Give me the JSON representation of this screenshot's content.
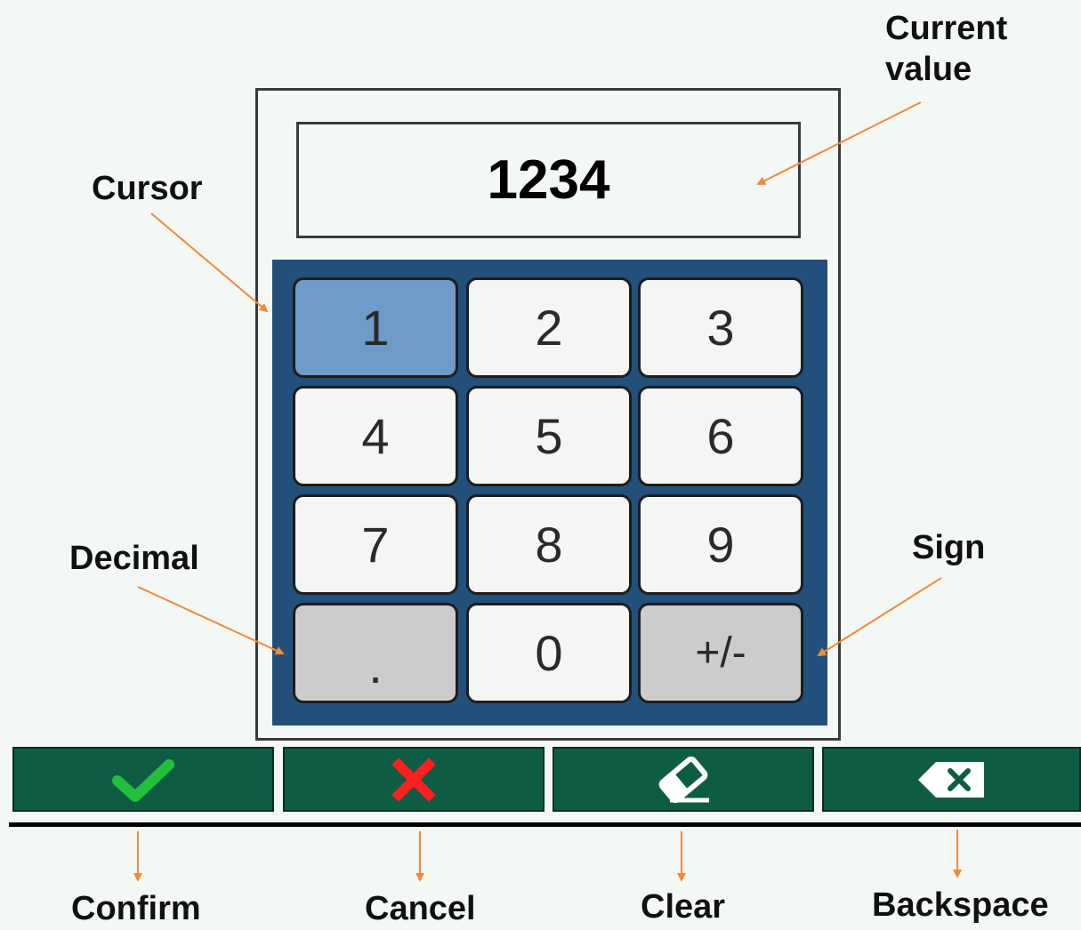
{
  "display": {
    "value": "1234"
  },
  "keypad": {
    "keys": [
      {
        "label": "1",
        "state": "cursor"
      },
      {
        "label": "2",
        "state": "normal"
      },
      {
        "label": "3",
        "state": "normal"
      },
      {
        "label": "4",
        "state": "normal"
      },
      {
        "label": "5",
        "state": "normal"
      },
      {
        "label": "6",
        "state": "normal"
      },
      {
        "label": "7",
        "state": "normal"
      },
      {
        "label": "8",
        "state": "normal"
      },
      {
        "label": "9",
        "state": "normal"
      },
      {
        "label": ".",
        "state": "special"
      },
      {
        "label": "0",
        "state": "normal"
      },
      {
        "label": "+/-",
        "state": "special"
      }
    ]
  },
  "toolbar": {
    "buttons": [
      {
        "icon": "check-icon",
        "color": "#22c03a"
      },
      {
        "icon": "x-icon",
        "color": "#ff2020"
      },
      {
        "icon": "eraser-icon",
        "color": "#ffffff"
      },
      {
        "icon": "backspace-icon",
        "color": "#ffffff"
      }
    ]
  },
  "annotations": {
    "current_value": "Current\nvalue",
    "cursor": "Cursor",
    "decimal": "Decimal",
    "sign": "Sign",
    "confirm": "Confirm",
    "cancel": "Cancel",
    "clear": "Clear",
    "backspace": "Backspace"
  },
  "colors": {
    "arrow": "#f08a3c",
    "keypad_bg": "#234f7b",
    "toolbar_bg": "#0f5c45"
  }
}
